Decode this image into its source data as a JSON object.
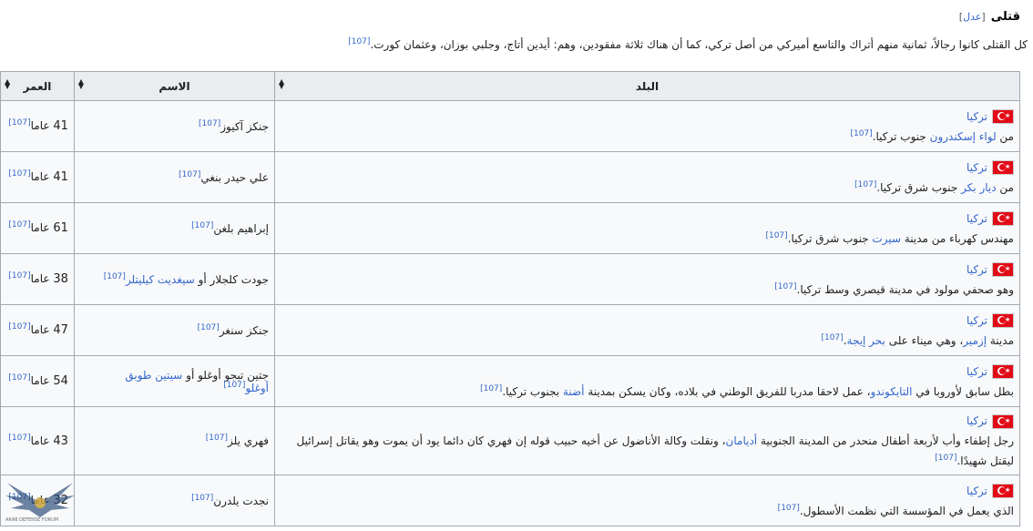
{
  "section": {
    "title": "قتلى",
    "edit_open": "[",
    "edit_label": "عدل",
    "edit_close": "]"
  },
  "intro": {
    "text": "كل القتلى كانوا رجالاً، ثمانية منهم أتراك والتاسع أميركي من أصل تركي، كما أن هناك ثلاثة مفقودين، وهم: أيدين أتاج، وجلبي بوزان، وعثمان كورت.",
    "ref": "[107]"
  },
  "table": {
    "headers": {
      "country": "البلد",
      "name": "الاسم",
      "age": "العمر"
    },
    "rows": [
      {
        "country": "تركيا",
        "desc_parts": [
          "من ",
          "لواء إسكندرون",
          " جنوب تركيا."
        ],
        "desc_links": [
          1
        ],
        "desc_ref": "[107]",
        "name_parts": [
          "جنكز آكيوز"
        ],
        "name_links": [],
        "name_ref": "[107]",
        "age_num": "41",
        "age_unit": " عاما",
        "age_ref": "[107]"
      },
      {
        "country": "تركيا",
        "desc_parts": [
          "من ",
          "ديار بكر",
          " جنوب شرق تركيا."
        ],
        "desc_links": [
          1
        ],
        "desc_ref": "[107]",
        "name_parts": [
          "علي حيدر بنغي"
        ],
        "name_links": [],
        "name_ref": "[107]",
        "age_num": "41",
        "age_unit": " عاما",
        "age_ref": "[107]"
      },
      {
        "country": "تركيا",
        "desc_parts": [
          "مهندس كهرباء من مدينة ",
          "سيرت",
          " جنوب شرق تركيا."
        ],
        "desc_links": [
          1
        ],
        "desc_ref": "[107]",
        "name_parts": [
          "إبراهيم بلغن"
        ],
        "name_links": [],
        "name_ref": "[107]",
        "age_num": "61",
        "age_unit": " عاما",
        "age_ref": "[107]"
      },
      {
        "country": "تركيا",
        "desc_parts": [
          "وهو صحفي مولود في مدينة قيصري وسط تركيا."
        ],
        "desc_links": [],
        "desc_ref": "[107]",
        "name_parts": [
          "جودت كلجلار أو ",
          "سيغديت كيليتلر"
        ],
        "name_links": [
          1
        ],
        "name_ref": "[107]",
        "age_num": "38",
        "age_unit": " عاما",
        "age_ref": "[107]"
      },
      {
        "country": "تركيا",
        "desc_parts": [
          "مدينة ",
          "إزمير",
          "، وهي ميناء على ",
          "بحر إيجة",
          "."
        ],
        "desc_links": [
          1,
          3
        ],
        "desc_ref": "[107]",
        "name_parts": [
          "جنكز سنغر"
        ],
        "name_links": [],
        "name_ref": "[107]",
        "age_num": "47",
        "age_unit": " عاما",
        "age_ref": "[107]"
      },
      {
        "country": "تركيا",
        "desc_parts": [
          "بطل سابق لأوروبا في ",
          "التايكوندو",
          "، عمل لاحقا مدربا للفريق الوطني في بلاده، وكان يسكن بمدينة ",
          "أضنة",
          " بجنوب تركيا."
        ],
        "desc_links": [
          1,
          3
        ],
        "desc_ref": "[107]",
        "name_parts": [
          "جتين تبجو أوغلو أو ",
          "سيتين طوبق أوغلو"
        ],
        "name_links": [
          1
        ],
        "name_ref": "[107]",
        "age_num": "54",
        "age_unit": " عاما",
        "age_ref": "[107]"
      },
      {
        "country": "تركيا",
        "desc_parts": [
          "رجل إطفاء وأب لأربعة أطفال منحدر من المدينة الجنوبية ",
          "أديامان",
          "، ونقلت وكالة الأناضول عن أخيه حبيب قوله إن فهري كان دائما يود أن يموت وهو يقاتل إسرائيل ليقتل شهيدًا."
        ],
        "desc_links": [
          1
        ],
        "desc_ref": "[107]",
        "name_parts": [
          "فهري يلز"
        ],
        "name_links": [],
        "name_ref": "[107]",
        "age_num": "43",
        "age_unit": " عاما",
        "age_ref": "[107]"
      },
      {
        "country": "تركيا",
        "desc_parts": [
          "الذي يعمل في المؤسسة التي نظمت الأسطول."
        ],
        "desc_links": [],
        "desc_ref": "[107]",
        "name_parts": [
          "نجدت يلدرن"
        ],
        "name_links": [],
        "name_ref": "[107]",
        "age_num": "32",
        "age_unit": " عاما",
        "age_ref": "[107]"
      }
    ]
  },
  "watermark": {
    "brand": "ARAB DEFENSE FORUM"
  },
  "colors": {
    "link": "#3366cc",
    "header_bg": "#eaecf0",
    "border": "#a2a9b1",
    "flag_red": "#e30a17"
  }
}
